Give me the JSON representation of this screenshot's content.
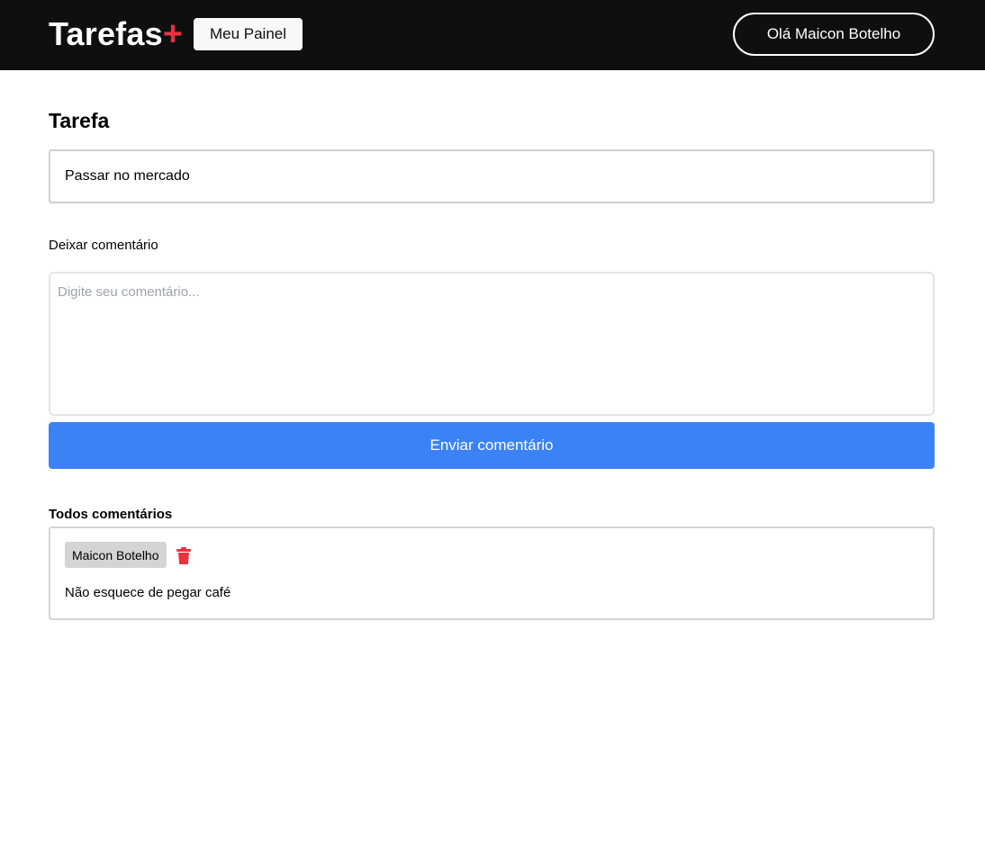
{
  "header": {
    "logo_text": "Tarefas",
    "logo_plus": "+",
    "panel_button": "Meu Painel",
    "user_button": "Olá Maicon Botelho"
  },
  "task": {
    "title": "Tarefa",
    "text": "Passar no mercado"
  },
  "comment_form": {
    "label": "Deixar comentário",
    "placeholder": "Digite seu comentário...",
    "value": "",
    "submit_label": "Enviar comentário"
  },
  "comments": {
    "title": "Todos comentários",
    "items": [
      {
        "author": "Maicon Botelho",
        "text": "Não esquece de pegar café",
        "delete_icon": "trash-icon"
      }
    ]
  },
  "colors": {
    "header_bg": "#0f0f0f",
    "accent_red": "#ea3140",
    "primary_blue": "#3b82f6"
  }
}
